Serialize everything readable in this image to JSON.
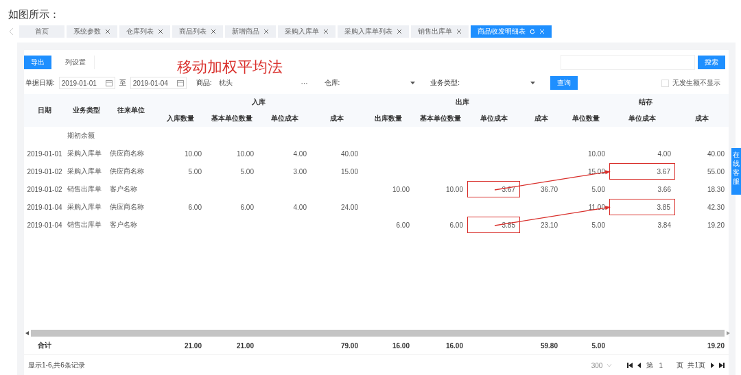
{
  "intro": "如图所示：",
  "tabs": [
    {
      "label": "首页",
      "closable": false,
      "selected": false
    },
    {
      "label": "系统参数",
      "closable": true,
      "selected": false
    },
    {
      "label": "仓库列表",
      "closable": true,
      "selected": false
    },
    {
      "label": "商品列表",
      "closable": true,
      "selected": false
    },
    {
      "label": "新增商品",
      "closable": true,
      "selected": false
    },
    {
      "label": "采购入库单",
      "closable": true,
      "selected": false
    },
    {
      "label": "采购入库单列表",
      "closable": true,
      "selected": false
    },
    {
      "label": "销售出库单",
      "closable": true,
      "selected": false
    },
    {
      "label": "商品收发明细表",
      "closable": true,
      "selected": true
    }
  ],
  "toolbar": {
    "export_button": "导出",
    "column_settings_button": "列设置",
    "search_button": "搜索"
  },
  "annotation_title": "移动加权平均法",
  "filters": {
    "date_label": "单据日期:",
    "date_from": "2019-01-01",
    "date_to_label": "至",
    "date_to": "2019-01-04",
    "product_label": "商品:",
    "product": "枕头",
    "product_more": "···",
    "warehouse_label": "仓库:",
    "type_label": "业务类型:",
    "query_button": "查询",
    "hide_zero": {
      "label": "无发生额不显示",
      "checked": false
    }
  },
  "table": {
    "columns": [
      "日期",
      "业务类型",
      "往来单位"
    ],
    "groups": [
      {
        "label": "入库",
        "columns": [
          "入库数量",
          "基本单位数量",
          "单位成本",
          "成本"
        ]
      },
      {
        "label": "出库",
        "columns": [
          "出库数量",
          "基本单位数量",
          "单位成本",
          "成本"
        ]
      },
      {
        "label": "结存",
        "columns": [
          "单位数量",
          "单位成本",
          "成本"
        ]
      }
    ],
    "rows": [
      {
        "type": "期初余额"
      },
      {
        "date": "2019-01-01",
        "type": "采购入库单",
        "partner": "供应商名称",
        "in_qty": "10.00",
        "in_base": "10.00",
        "in_unit": "4.00",
        "in_cost": "40.00",
        "bal_qty": "10.00",
        "bal_unit": "4.00",
        "bal_cost": "40.00"
      },
      {
        "date": "2019-01-02",
        "type": "采购入库单",
        "partner": "供应商名称",
        "in_qty": "5.00",
        "in_base": "5.00",
        "in_unit": "3.00",
        "in_cost": "15.00",
        "bal_qty": "15.00",
        "bal_unit": {
          "text": "3.67",
          "boxed": true
        },
        "bal_cost": "55.00"
      },
      {
        "date": "2019-01-02",
        "type": "销售出库单",
        "partner": "客户名称",
        "out_qty": "10.00",
        "out_base": "10.00",
        "out_unit": {
          "text": "3.67",
          "boxed": true
        },
        "out_cost": "36.70",
        "bal_qty": "5.00",
        "bal_unit": "3.66",
        "bal_cost": "18.30"
      },
      {
        "date": "2019-01-04",
        "type": "采购入库单",
        "partner": "供应商名称",
        "in_qty": "6.00",
        "in_base": "6.00",
        "in_unit": "4.00",
        "in_cost": "24.00",
        "bal_qty": "11.00",
        "bal_unit": {
          "text": "3.85",
          "boxed": true
        },
        "bal_cost": "42.30"
      },
      {
        "date": "2019-01-04",
        "type": "销售出库单",
        "partner": "客户名称",
        "out_qty": "6.00",
        "out_base": "6.00",
        "out_unit": {
          "text": "3.85",
          "boxed": true
        },
        "out_cost": "23.10",
        "bal_qty": "5.00",
        "bal_unit": "3.84",
        "bal_cost": "19.20"
      }
    ],
    "totals": {
      "date": "合计",
      "in_qty": "21.00",
      "in_base": "21.00",
      "in_cost": "79.00",
      "out_qty": "16.00",
      "out_base": "16.00",
      "out_cost": "59.80",
      "bal_qty": "5.00",
      "bal_cost": "19.20"
    }
  },
  "footer": {
    "summary": "显示1-6,共6条记录",
    "page_size": "300",
    "page_label_before": "第",
    "page": "1",
    "page_label_after": "页",
    "total_pages": "共1页"
  },
  "side_tab": "在线客服"
}
